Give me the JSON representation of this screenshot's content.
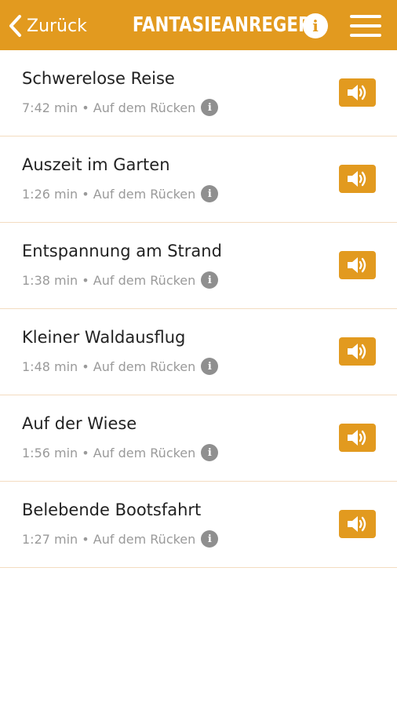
{
  "header": {
    "back_label": "Zurück",
    "title": "FANTASIEANREGER",
    "info_glyph": "i",
    "back_icon": "chevron-left-icon",
    "menu_icon": "hamburger-menu-icon"
  },
  "colors": {
    "accent": "#e29a1f",
    "divider": "#f3dcc0",
    "subtext": "#9a9a9a",
    "info_grey": "#8f8f8f"
  },
  "items": [
    {
      "title": "Schwerelose Reise",
      "duration": "7:42 min",
      "position": "Auf dem Rücken"
    },
    {
      "title": "Auszeit im Garten",
      "duration": "1:26 min",
      "position": "Auf dem Rücken"
    },
    {
      "title": "Entspannung am Strand",
      "duration": "1:38 min",
      "position": "Auf dem Rücken"
    },
    {
      "title": "Kleiner Waldausflug",
      "duration": "1:48 min",
      "position": "Auf dem Rücken"
    },
    {
      "title": "Auf der Wiese",
      "duration": "1:56 min",
      "position": "Auf dem Rücken"
    },
    {
      "title": "Belebende Bootsfahrt",
      "duration": "1:27 min",
      "position": "Auf dem Rücken"
    }
  ],
  "separator": " • ",
  "item_info_glyph": "i",
  "item_action_icon": "speaker-icon"
}
